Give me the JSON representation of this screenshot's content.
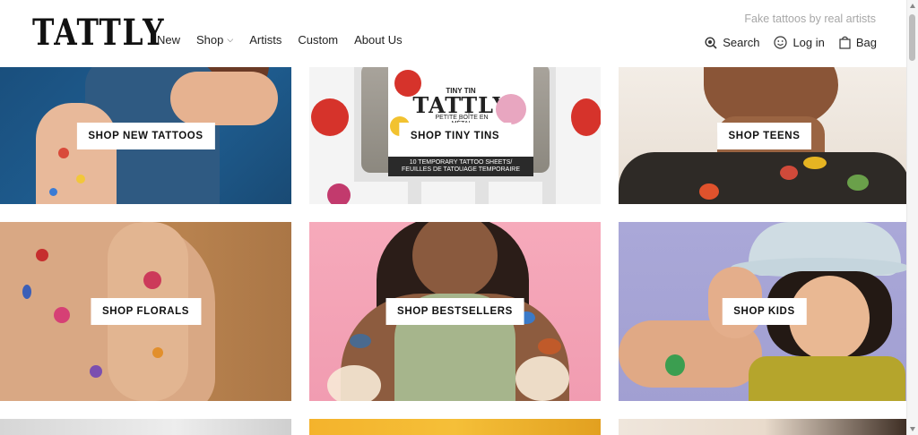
{
  "brand": {
    "logo": "TATTLY"
  },
  "header": {
    "tagline": "Fake tattoos by real artists",
    "nav": [
      {
        "label": "New"
      },
      {
        "label": "Shop",
        "has_dropdown": true
      },
      {
        "label": "Artists"
      },
      {
        "label": "Custom"
      },
      {
        "label": "About Us"
      }
    ],
    "utils": {
      "search": "Search",
      "login": "Log in",
      "bag": "Bag"
    }
  },
  "tiles": [
    {
      "label": "SHOP NEW TATTOOS"
    },
    {
      "label": "SHOP TINY TINS"
    },
    {
      "label": "SHOP TEENS"
    },
    {
      "label": "SHOP FLORALS"
    },
    {
      "label": "SHOP BESTSELLERS"
    },
    {
      "label": "SHOP KIDS"
    }
  ],
  "tin": {
    "line1": "TINY TIN",
    "line2": "TATTLY",
    "line3": "PETITE BOÎTE EN MÉTAL",
    "line4": "10 TEMPORARY TATTOO SHEETS/",
    "line5": "FEUILLES DE TATOUAGE TEMPORAIRE"
  },
  "colors": {
    "tile1": "#1f5a8a",
    "tile2": "#e4e4e4",
    "tile3": "#efe6dc",
    "tile4": "#b47c4e",
    "tile5": "#f5a7b9",
    "tile6": "#a9a7d6",
    "tile7": "#e0e0e0",
    "tile8": "#f5b731",
    "tile9": "#efe6dc"
  }
}
